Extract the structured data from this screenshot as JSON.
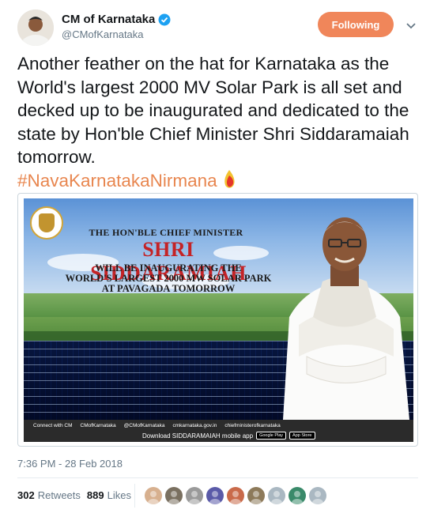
{
  "author": {
    "display_name": "CM of Karnataka",
    "handle": "@CMofKarnataka",
    "verified": true,
    "avatar_icon": "profile-photo"
  },
  "follow_button": {
    "label": "Following",
    "color": "#f0865a"
  },
  "menu": {
    "icon": "chevron-down-icon"
  },
  "tweet": {
    "text": "Another feather on the hat for Karnataka as the World's largest 2000 MV  Solar Park is all set and decked up to be inaugurated and dedicated to the state by Hon'ble Chief Minister Shri Siddaramaiah tomorrow.",
    "hashtag": "#NavaKarnatakaNirmana",
    "hashtag_color": "#e8864f",
    "emoji_icon": "karnataka-flag-icon"
  },
  "media": {
    "line1": "THE HON'BLE CHIEF MINISTER",
    "line2": "SHRI SIDDARAMIAH",
    "line3a": "WILL BE INAUGURATING THE",
    "line3b": "WORLD'S LARGEST 2000 MW SOLAR PARK",
    "line3c": "AT PAVAGADA TOMORROW",
    "emblem_label": "GOVERNMENT OF KARNATAKA",
    "footer_connect": "Connect with CM",
    "footer_fb": "CMofKarnataka",
    "footer_tw": "@CMofKarnataka",
    "footer_web": "cmkarnataka.gov.in",
    "footer_yt": "chiefministerofkarnataka",
    "footer_download": "Download SIDDARAMAIAH mobile app",
    "badge_google": "Google Play",
    "badge_apple": "App Store"
  },
  "timestamp": "7:36 PM - 28 Feb 2018",
  "stats": {
    "retweets_count": "302",
    "retweets_label": "Retweets",
    "likes_count": "889",
    "likes_label": "Likes"
  },
  "likers": [
    {
      "color": "#d7b08f"
    },
    {
      "color": "#7a7060"
    },
    {
      "color": "#9a9a9a"
    },
    {
      "color": "#5a5aa8"
    },
    {
      "color": "#c96a4a"
    },
    {
      "color": "#8d7a5a"
    },
    {
      "color": "#aab8c2"
    },
    {
      "color": "#3a8a6a"
    },
    {
      "color": "#aab8c2"
    }
  ]
}
